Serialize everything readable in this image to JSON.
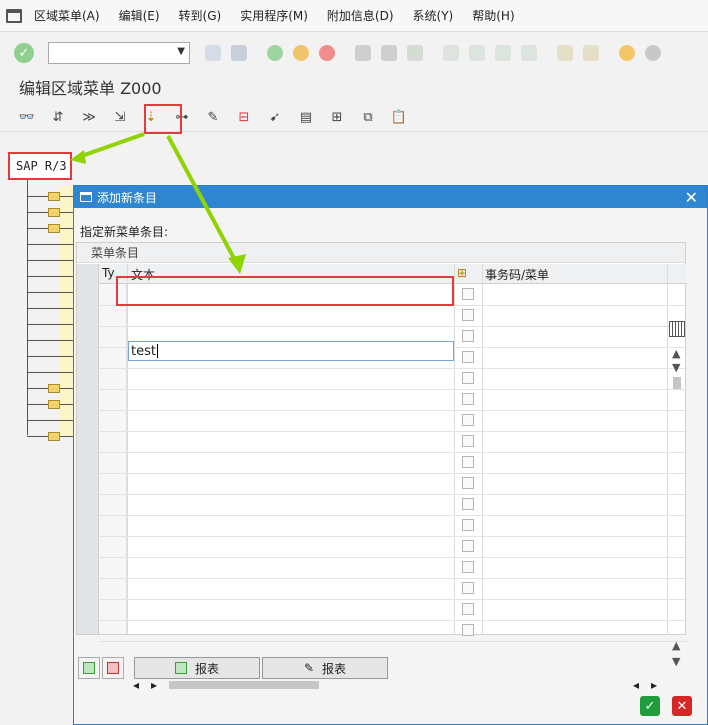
{
  "menu": {
    "items": [
      "区域菜单(A)",
      "编辑(E)",
      "转到(G)",
      "实用程序(M)",
      "附加信息(D)",
      "系统(Y)",
      "帮助(H)"
    ]
  },
  "page": {
    "title": "编辑区域菜单 Z000"
  },
  "tree": {
    "root_label": "SAP R/3"
  },
  "dialog": {
    "title": "添加新条目",
    "instruction": "指定新菜单条目:",
    "grid_caption": "菜单条目",
    "columns": {
      "type": "Ty",
      "text": "文本",
      "tcode": "事务码/菜单"
    },
    "rows": [
      {
        "text": "test"
      }
    ],
    "report_button_1": "报表",
    "report_button_2": "报表"
  },
  "colors": {
    "highlight": "#e23b3b",
    "arrow": "#8fd400",
    "title_bar": "#2f86d0"
  },
  "icons": [
    "app-menu-icon",
    "enter-icon",
    "save-icon",
    "back-icon",
    "exit-icon",
    "cancel-icon",
    "print-icon",
    "find-icon",
    "help-icon",
    "settings-icon"
  ]
}
